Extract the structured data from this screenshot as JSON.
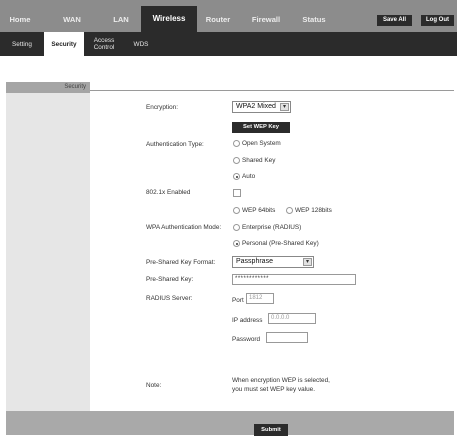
{
  "nav": {
    "tabs": [
      {
        "label": "Home"
      },
      {
        "label": "WAN"
      },
      {
        "label": "LAN"
      },
      {
        "label": "Wireless"
      },
      {
        "label": "Router"
      },
      {
        "label": "Firewall"
      },
      {
        "label": "Status"
      }
    ],
    "active_tab": "Wireless",
    "save_all": "Save All",
    "log_out": "Log Out"
  },
  "subnav": {
    "tabs": [
      {
        "label": "Setting"
      },
      {
        "label": "Security"
      },
      {
        "label": "Access Control"
      },
      {
        "label": "WDS"
      }
    ],
    "active_tab": "Security"
  },
  "section": {
    "title": "Security"
  },
  "form": {
    "encryption": {
      "label": "Encryption:",
      "value": "WPA2 Mixed"
    },
    "set_wep_key": "Set WEP Key",
    "auth_type": {
      "label": "Authentication Type:",
      "options": [
        "Open System",
        "Shared Key",
        "Auto"
      ],
      "selected": "Auto"
    },
    "dot1x": {
      "label": "802.1x Enabled",
      "checked": false
    },
    "wep_bits": {
      "options": [
        "WEP 64bits",
        "WEP 128bits"
      ],
      "selected": ""
    },
    "wpa_mode": {
      "label": "WPA Authentication Mode:",
      "options": [
        "Enterprise (RADIUS)",
        "Personal (Pre-Shared Key)"
      ],
      "selected": "Personal (Pre-Shared Key)"
    },
    "psk_format": {
      "label": "Pre-Shared Key Format:",
      "value": "Passphrase"
    },
    "psk": {
      "label": "Pre-Shared Key:",
      "value": "************"
    },
    "radius": {
      "label": "RADIUS Server:",
      "port_label": "Port",
      "port_placeholder": "1812",
      "ip_label": "IP address",
      "ip_placeholder": "0.0.0.0",
      "password_label": "Password",
      "password_value": ""
    },
    "note": {
      "label": "Note:",
      "line1": "When encryption WEP is selected,",
      "line2": "you must set WEP key value."
    },
    "submit": "Submit"
  },
  "colors": {
    "nav_bg": "#8c8c8c",
    "dark": "#2b2b2b",
    "sidebar": "#e6e6e6",
    "footer": "#a9a9a9"
  },
  "icons": {
    "dropdown": "chevron-down-icon",
    "radio": "radio-icon",
    "checkbox": "checkbox-icon"
  }
}
